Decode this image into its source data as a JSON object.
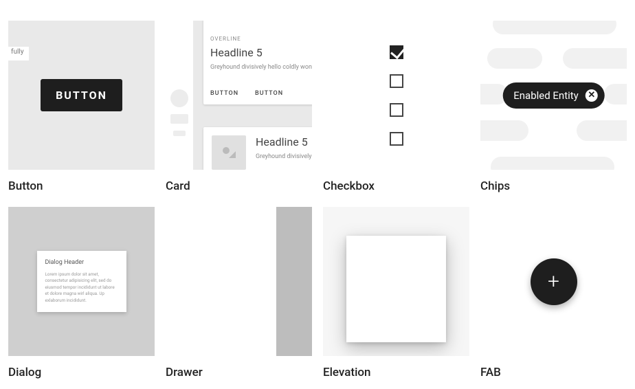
{
  "components": {
    "button": {
      "title": "Button",
      "label": "BUTTON",
      "cut": "fully"
    },
    "card": {
      "title": "Card",
      "overline": "OVERLINE",
      "headline1": "Headline 5",
      "body1": "Greyhound divisively hello coldly wonderfully...",
      "btn1": "BUTTON",
      "btn2": "BUTTON",
      "headline2": "Headline 5",
      "body2": "Greyhound divisively coldly..."
    },
    "checkbox": {
      "title": "Checkbox"
    },
    "chips": {
      "title": "Chips",
      "chip_label": "Enabled Entity",
      "close_glyph": "✕"
    },
    "dialog": {
      "title": "Dialog",
      "header": "Dialog Header",
      "body": "Lorem ipsum dolor sit amet, consectetur adipisicing elit, sed do eiusmod tempor incididunt ut labore et dolore magna wirl aliqua. Up exlaborum incididunt."
    },
    "drawer": {
      "title": "Drawer"
    },
    "elevation": {
      "title": "Elevation"
    },
    "fab": {
      "title": "FAB",
      "glyph": "+"
    }
  }
}
